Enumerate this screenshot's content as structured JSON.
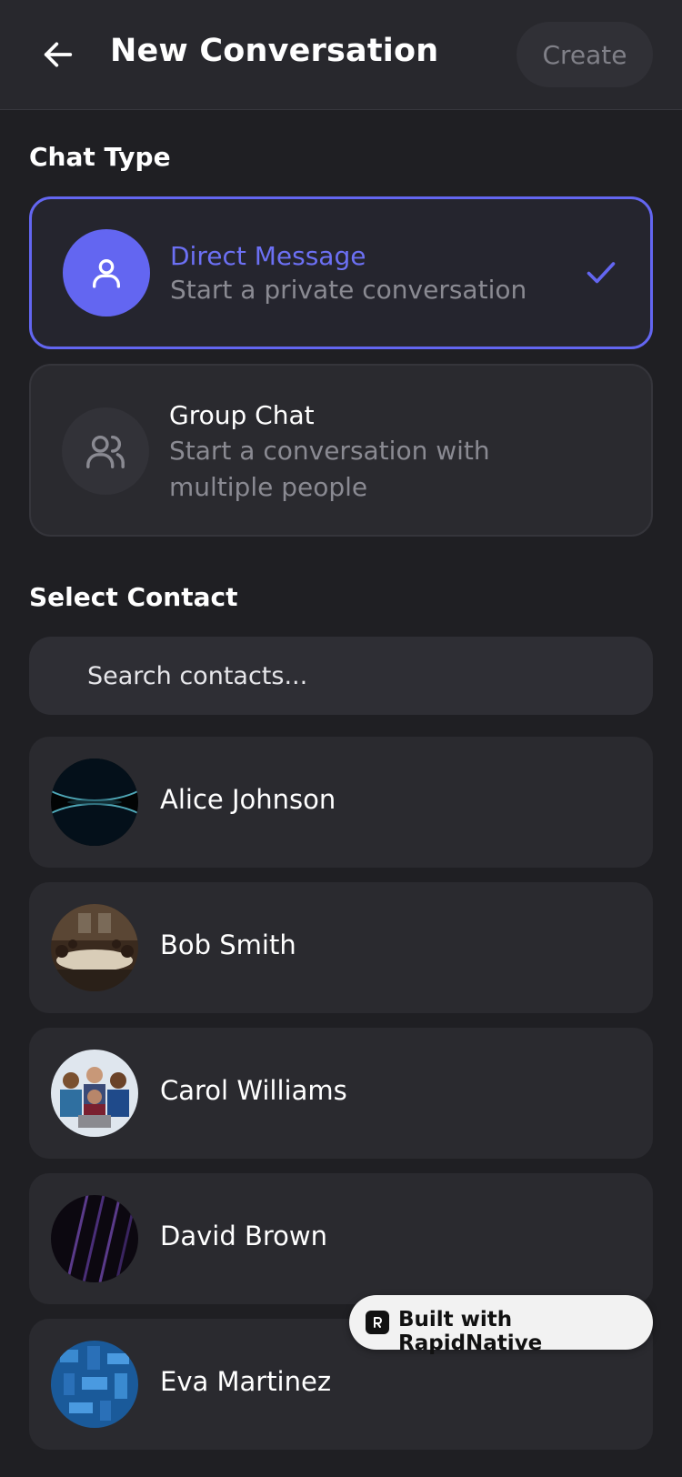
{
  "header": {
    "title": "New Conversation",
    "create_label": "Create"
  },
  "chat_type": {
    "section_title": "Chat Type",
    "options": [
      {
        "label": "Direct Message",
        "description": "Start a private conversation",
        "selected": true,
        "icon": "user-icon"
      },
      {
        "label": "Group Chat",
        "description": "Start a conversation with multiple people",
        "selected": false,
        "icon": "users-icon"
      }
    ]
  },
  "contacts": {
    "section_title": "Select Contact",
    "search_placeholder": "Search contacts...",
    "items": [
      {
        "name": "Alice Johnson"
      },
      {
        "name": "Bob Smith"
      },
      {
        "name": "Carol Williams"
      },
      {
        "name": "David Brown"
      },
      {
        "name": "Eva Martinez"
      }
    ]
  },
  "badge": {
    "text": "Built with RapidNative"
  },
  "colors": {
    "background": "#1f1f23",
    "accent": "#6366f1",
    "card": "#2a2a2f",
    "muted_text": "#8a8a92"
  }
}
